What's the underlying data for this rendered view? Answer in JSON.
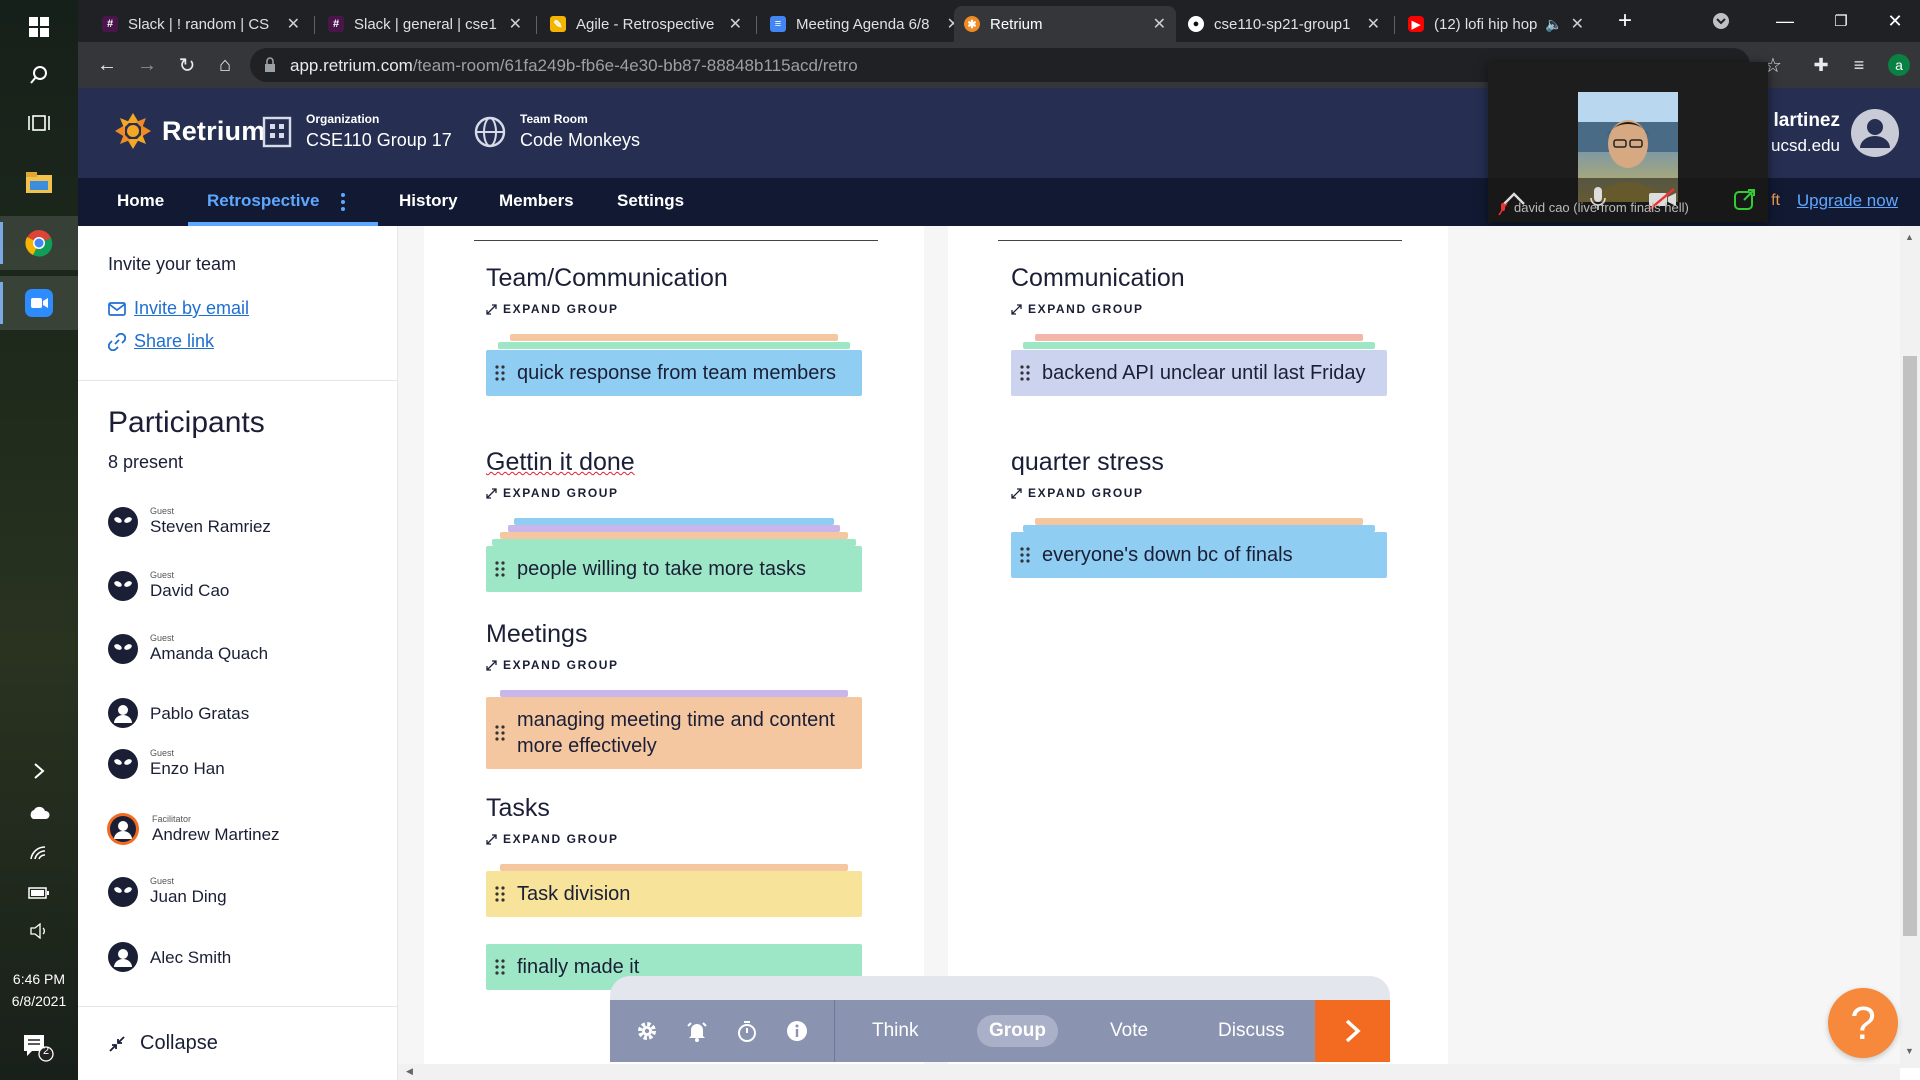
{
  "taskbar": {
    "time": "6:46 PM",
    "date": "6/8/2021",
    "notification_count": "2"
  },
  "browser": {
    "tabs": [
      {
        "title": "Slack | ! random | CS",
        "icon": "slack-icon"
      },
      {
        "title": "Slack | general | cse1",
        "icon": "slack-icon"
      },
      {
        "title": "Agile - Retrospective",
        "icon": "pen-icon"
      },
      {
        "title": "Meeting Agenda 6/8",
        "icon": "docs-icon"
      },
      {
        "title": "Retrium",
        "icon": "retrium-icon",
        "active": true
      },
      {
        "title": "cse110-sp21-group1",
        "icon": "github-icon"
      },
      {
        "title": "(12) lofi hip hop",
        "icon": "youtube-icon"
      }
    ],
    "url_host": "app.retrium.com",
    "url_path": "/team-room/61fa249b-fb6e-4e30-bb87-88848b115acd/retro",
    "profile_initial": "a"
  },
  "header": {
    "brand": "Retrium",
    "org_label": "Organization",
    "org_value": "CSE110 Group 17",
    "room_label": "Team Room",
    "room_value": "Code Monkeys",
    "user_name": "lartinez",
    "user_email": "ucsd.edu"
  },
  "nav": {
    "home": "Home",
    "retrospective": "Retrospective",
    "history": "History",
    "members": "Members",
    "settings": "Settings",
    "upgrade_prefix": "ft",
    "upgrade": "Upgrade now"
  },
  "zoom": {
    "participant_label": "david cao (live from finals hell)"
  },
  "sidebar": {
    "invite_title": "Invite your team",
    "invite_email": "Invite by email",
    "share_link": "Share link",
    "participants_title": "Participants",
    "participants_count": "8 present",
    "participants": [
      {
        "role": "Guest",
        "name": "Steven Ramriez",
        "avatar": "alien-icon"
      },
      {
        "role": "Guest",
        "name": "David Cao",
        "avatar": "alien-icon"
      },
      {
        "role": "Guest",
        "name": "Amanda Quach",
        "avatar": "alien-icon"
      },
      {
        "role": "",
        "name": "Pablo Gratas",
        "avatar": "user-icon"
      },
      {
        "role": "Guest",
        "name": "Enzo Han",
        "avatar": "alien-icon"
      },
      {
        "role": "Facilitator",
        "name": "Andrew Martinez",
        "avatar": "user-icon"
      },
      {
        "role": "Guest",
        "name": "Juan Ding",
        "avatar": "alien-icon"
      },
      {
        "role": "",
        "name": "Alec Smith",
        "avatar": "user-icon"
      }
    ],
    "collapse": "Collapse"
  },
  "board": {
    "expand_label": "EXPAND GROUP",
    "left_groups": [
      {
        "title": "Team/Communication",
        "cards": [
          "quick response from team members"
        ]
      },
      {
        "title": "Gettin it done",
        "cards": [
          "people willing to take more tasks"
        ]
      },
      {
        "title": "Meetings",
        "cards": [
          "managing meeting time and content more effectively"
        ]
      },
      {
        "title": "Tasks",
        "cards": [
          "Task division",
          "finally made it"
        ]
      }
    ],
    "right_groups": [
      {
        "title": "Communication",
        "cards": [
          "backend API unclear until last Friday"
        ]
      },
      {
        "title": "quarter stress",
        "cards": [
          "everyone's down bc of finals"
        ]
      }
    ],
    "colors": {
      "blue": "#8fcdf3",
      "green": "#9de6c6",
      "orange": "#f5c7a1",
      "yellow": "#f8e39a",
      "lavender": "#ccd3ee",
      "purple": "#c9b6ea",
      "salmon": "#f3b6a8"
    }
  },
  "phases": {
    "think": "Think",
    "group": "Group",
    "vote": "Vote",
    "discuss": "Discuss",
    "current": "Group"
  },
  "help": "?"
}
